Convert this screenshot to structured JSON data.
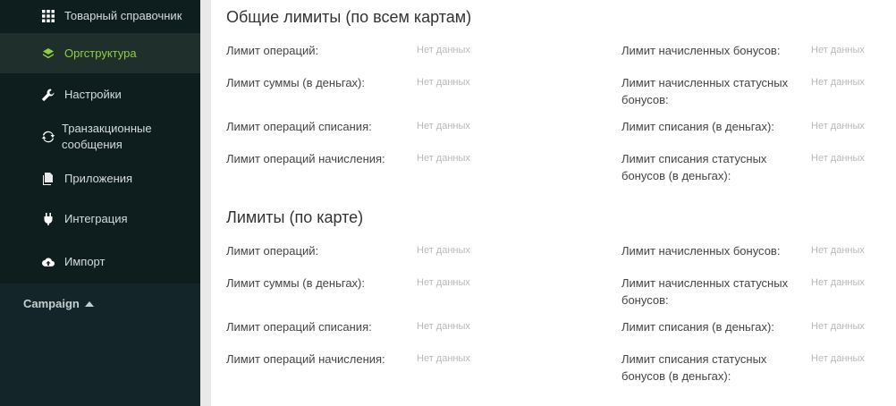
{
  "sidebar": {
    "items": [
      {
        "label": "Товарный справочник",
        "icon": "grid-icon"
      },
      {
        "label": "Оргструктура",
        "icon": "layers-icon",
        "active": true
      },
      {
        "label": "Настройки",
        "icon": "wrench-icon"
      },
      {
        "label": "Транзакционные сообщения",
        "icon": "refresh-icon"
      },
      {
        "label": "Приложения",
        "icon": "copy-icon"
      },
      {
        "label": "Интеграция",
        "icon": "plug-icon"
      },
      {
        "label": "Импорт",
        "icon": "cloud-upload-icon"
      }
    ],
    "campaign_label": "Campaign"
  },
  "main": {
    "general_limits": {
      "title": "Общие лимиты (по всем картам)",
      "rows": [
        {
          "left_label": "Лимит операций:",
          "left_value": "Нет данных",
          "right_label": "Лимит начисленных бонусов:",
          "right_value": "Нет данных"
        },
        {
          "left_label": "Лимит суммы (в деньгах):",
          "left_value": "Нет данных",
          "right_label": "Лимит начисленных статусных бонусов:",
          "right_value": "Нет данных"
        },
        {
          "left_label": "Лимит операций списания:",
          "left_value": "Нет данных",
          "right_label": "Лимит списания (в деньгах):",
          "right_value": "Нет данных"
        },
        {
          "left_label": "Лимит операций начисления:",
          "left_value": "Нет данных",
          "right_label": "Лимит списания статусных бонусов (в деньгах):",
          "right_value": "Нет данных"
        }
      ]
    },
    "card_limits": {
      "title": "Лимиты (по карте)",
      "rows": [
        {
          "left_label": "Лимит операций:",
          "left_value": "Нет данных",
          "right_label": "Лимит начисленных бонусов:",
          "right_value": "Нет данных"
        },
        {
          "left_label": "Лимит суммы (в деньгах):",
          "left_value": "Нет данных",
          "right_label": "Лимит начисленных статусных бонусов:",
          "right_value": "Нет данных"
        },
        {
          "left_label": "Лимит операций списания:",
          "left_value": "Нет данных",
          "right_label": "Лимит списания (в деньгах):",
          "right_value": "Нет данных"
        },
        {
          "left_label": "Лимит операций начисления:",
          "left_value": "Нет данных",
          "right_label": "Лимит списания статусных бонусов (в деньгах):",
          "right_value": "Нет данных"
        }
      ]
    }
  }
}
